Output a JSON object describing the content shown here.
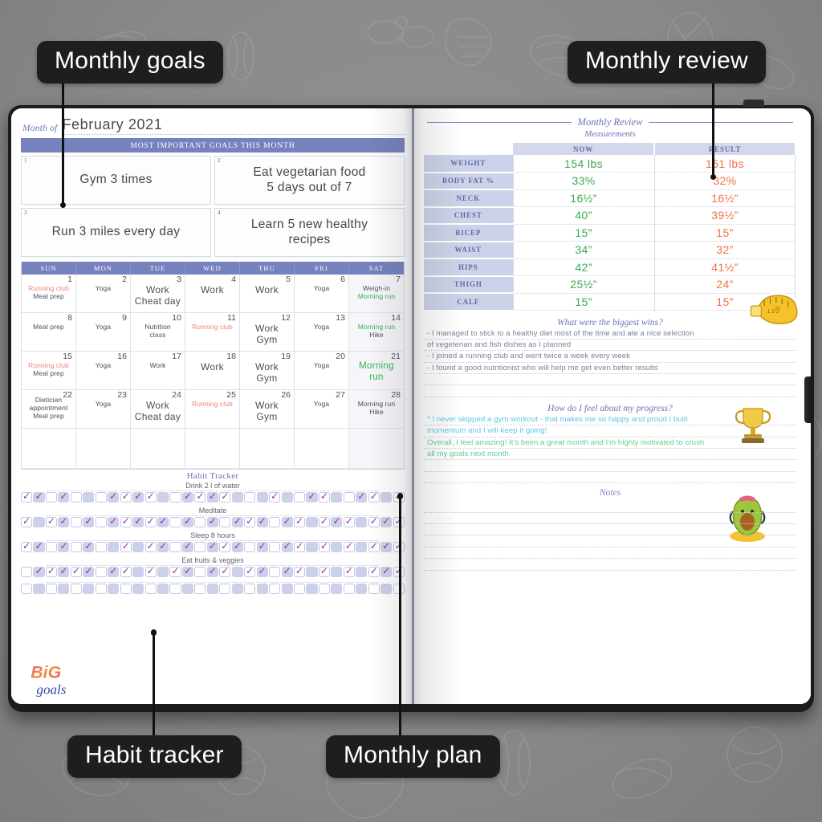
{
  "callouts": [
    {
      "label": "Monthly goals",
      "name": "callout-monthly-goals"
    },
    {
      "label": "Monthly review",
      "name": "callout-monthly-review"
    },
    {
      "label": "Habit tracker",
      "name": "callout-habit-tracker"
    },
    {
      "label": "Monthly plan",
      "name": "callout-monthly-plan"
    }
  ],
  "left_page": {
    "month_label": "Month of",
    "month_value": "February 2021",
    "goals_header": "MOST IMPORTANT GOALS THIS MONTH",
    "goals": [
      {
        "num": "1",
        "text": "Gym 3 times"
      },
      {
        "num": "2",
        "text": "Eat vegetarian food\n5 days out of 7"
      },
      {
        "num": "3",
        "text": "Run 3 miles every day"
      },
      {
        "num": "4",
        "text": "Learn 5 new healthy\nrecipes"
      }
    ],
    "weekday_headers": [
      "SUN",
      "MON",
      "TUE",
      "WED",
      "THU",
      "FRI",
      "SAT"
    ],
    "calendar": [
      [
        {
          "num": "1",
          "events": [
            {
              "t": "Running club",
              "c": "red"
            },
            {
              "t": "Meal prep",
              "c": "gray"
            }
          ]
        },
        {
          "num": "2",
          "events": [
            {
              "t": "Yoga",
              "c": "gray"
            }
          ]
        },
        {
          "num": "3",
          "events": [
            {
              "t": "Work",
              "c": "gray",
              "big": true
            },
            {
              "t": "Cheat day",
              "c": "gray",
              "big": true
            }
          ]
        },
        {
          "num": "4",
          "events": [
            {
              "t": "Work",
              "c": "gray",
              "big": true
            }
          ]
        },
        {
          "num": "5",
          "events": [
            {
              "t": "Work",
              "c": "gray",
              "big": true
            }
          ]
        },
        {
          "num": "6",
          "events": [
            {
              "t": "Yoga",
              "c": "gray"
            }
          ]
        },
        {
          "num": "7",
          "events": [
            {
              "t": "Weigh-in",
              "c": "gray"
            },
            {
              "t": "Morning run",
              "c": "green"
            }
          ]
        }
      ],
      [
        {
          "num": "8",
          "events": [
            {
              "t": "Meal prep",
              "c": "gray"
            }
          ]
        },
        {
          "num": "9",
          "events": [
            {
              "t": "Yoga",
              "c": "gray"
            }
          ]
        },
        {
          "num": "10",
          "events": [
            {
              "t": "Nutrition",
              "c": "gray"
            },
            {
              "t": "class",
              "c": "gray"
            }
          ]
        },
        {
          "num": "11",
          "events": [
            {
              "t": "Running club",
              "c": "red"
            }
          ]
        },
        {
          "num": "12",
          "events": [
            {
              "t": "Work",
              "c": "gray",
              "big": true
            },
            {
              "t": "Gym",
              "c": "gray",
              "big": true
            }
          ]
        },
        {
          "num": "13",
          "events": [
            {
              "t": "Yoga",
              "c": "gray"
            }
          ]
        },
        {
          "num": "14",
          "events": [
            {
              "t": "Morning run",
              "c": "green"
            },
            {
              "t": "Hike",
              "c": "gray"
            }
          ]
        }
      ],
      [
        {
          "num": "15",
          "events": [
            {
              "t": "Running club",
              "c": "red"
            },
            {
              "t": "Meal prep",
              "c": "gray"
            }
          ]
        },
        {
          "num": "16",
          "events": [
            {
              "t": "Yoga",
              "c": "gray"
            }
          ]
        },
        {
          "num": "17",
          "events": [
            {
              "t": "Work",
              "c": "gray"
            }
          ]
        },
        {
          "num": "18",
          "events": [
            {
              "t": "Work",
              "c": "gray",
              "big": true
            }
          ]
        },
        {
          "num": "19",
          "events": [
            {
              "t": "Work",
              "c": "gray",
              "big": true
            },
            {
              "t": "Gym",
              "c": "gray",
              "big": true
            }
          ]
        },
        {
          "num": "20",
          "events": [
            {
              "t": "Yoga",
              "c": "gray"
            }
          ]
        },
        {
          "num": "21",
          "events": [
            {
              "t": "Morning",
              "c": "green",
              "big": true
            },
            {
              "t": "run",
              "c": "green",
              "big": true
            }
          ]
        }
      ],
      [
        {
          "num": "22",
          "events": [
            {
              "t": "Dietician",
              "c": "gray"
            },
            {
              "t": "appointment",
              "c": "gray"
            },
            {
              "t": "Meal prep",
              "c": "gray"
            }
          ]
        },
        {
          "num": "23",
          "events": [
            {
              "t": "Yoga",
              "c": "gray"
            }
          ]
        },
        {
          "num": "24",
          "events": [
            {
              "t": "Work",
              "c": "gray",
              "big": true
            },
            {
              "t": "Cheat day",
              "c": "gray",
              "big": true
            }
          ]
        },
        {
          "num": "25",
          "events": [
            {
              "t": "Running club",
              "c": "red"
            }
          ]
        },
        {
          "num": "26",
          "events": [
            {
              "t": "Work",
              "c": "gray",
              "big": true
            },
            {
              "t": "Gym",
              "c": "gray",
              "big": true
            }
          ]
        },
        {
          "num": "27",
          "events": [
            {
              "t": "Yoga",
              "c": "gray"
            }
          ]
        },
        {
          "num": "28",
          "events": [
            {
              "t": "Morning run",
              "c": "gray"
            },
            {
              "t": "Hike",
              "c": "gray"
            }
          ]
        }
      ],
      [
        {
          "num": "",
          "events": []
        },
        {
          "num": "",
          "events": []
        },
        {
          "num": "",
          "events": []
        },
        {
          "num": "",
          "events": []
        },
        {
          "num": "",
          "events": []
        },
        {
          "num": "",
          "events": []
        },
        {
          "num": "",
          "events": []
        }
      ]
    ],
    "sticker_big_goals": {
      "line1": "BiG",
      "line2": "goals"
    },
    "habit_tracker": {
      "title": "Habit Tracker",
      "rows": [
        {
          "label": "Drink 2 l of water",
          "checks": [
            1,
            1,
            0,
            1,
            0,
            0,
            0,
            1,
            1,
            1,
            1,
            0,
            0,
            1,
            1,
            1,
            1,
            0,
            0,
            0,
            1,
            0,
            0,
            1,
            1,
            0,
            0,
            1,
            1,
            0,
            1
          ]
        },
        {
          "label": "Meditate",
          "checks": [
            1,
            0,
            1,
            1,
            0,
            1,
            0,
            1,
            1,
            1,
            1,
            1,
            0,
            1,
            0,
            1,
            0,
            1,
            1,
            1,
            0,
            1,
            1,
            0,
            1,
            1,
            1,
            0,
            1,
            1,
            1
          ]
        },
        {
          "label": "Sleep 8 hours",
          "checks": [
            1,
            1,
            0,
            1,
            0,
            1,
            0,
            0,
            1,
            0,
            1,
            1,
            0,
            1,
            0,
            1,
            1,
            1,
            0,
            1,
            0,
            1,
            1,
            0,
            1,
            0,
            1,
            0,
            1,
            1,
            1
          ]
        },
        {
          "label": "Eat fruits & veggies",
          "checks": [
            0,
            1,
            1,
            1,
            1,
            1,
            0,
            1,
            1,
            0,
            1,
            0,
            1,
            1,
            0,
            1,
            1,
            0,
            1,
            1,
            0,
            1,
            1,
            0,
            1,
            0,
            1,
            0,
            1,
            1,
            1
          ]
        },
        {
          "label": "",
          "checks": [
            0,
            0,
            0,
            0,
            0,
            0,
            0,
            0,
            0,
            0,
            0,
            0,
            0,
            0,
            0,
            0,
            0,
            0,
            0,
            0,
            0,
            0,
            0,
            0,
            0,
            0,
            0,
            0,
            0,
            0,
            0
          ]
        }
      ]
    }
  },
  "right_page": {
    "review_title": "Monthly Review",
    "measurements_title": "Measurements",
    "table_headers": [
      "",
      "NOW",
      "RESULT"
    ],
    "measurements": [
      {
        "label": "WEIGHT",
        "now": "154 lbs",
        "result": "151 lbs"
      },
      {
        "label": "BODY FAT %",
        "now": "33%",
        "result": "32%"
      },
      {
        "label": "NECK",
        "now": "16½”",
        "result": "16½”"
      },
      {
        "label": "CHEST",
        "now": "40”",
        "result": "39½”"
      },
      {
        "label": "BICEP",
        "now": "15”",
        "result": "15”"
      },
      {
        "label": "WAIST",
        "now": "34”",
        "result": "32”"
      },
      {
        "label": "HIPS",
        "now": "42”",
        "result": "41½”"
      },
      {
        "label": "THIGH",
        "now": "25½”",
        "result": "24”"
      },
      {
        "label": "CALF",
        "now": "15”",
        "result": "15”"
      }
    ],
    "wins_title": "What were the biggest wins?",
    "wins_lines": [
      "- I managed to stick to a healthy diet most of the time and ate a nice selection",
      "of vegeterian and fish dishes as I planned",
      "- I joined a running club and went twice a week every week",
      "- I found a good nutritionist who will help me get even better results",
      "",
      ""
    ],
    "progress_title": "How do I feel about my progress?",
    "progress_lines": [
      {
        "text": "* I never skipped a gym workout - that makes me so happy and proud I built",
        "color": "blue"
      },
      {
        "text": "momentum and I will keep it going!",
        "color": "blue"
      },
      {
        "text": "Overall, I feel amazing! It's been a great month and I'm highly motivated to crush",
        "color": "green"
      },
      {
        "text": "all my goals next month",
        "color": "green"
      },
      {
        "text": "",
        "color": "green"
      },
      {
        "text": "",
        "color": "green"
      }
    ],
    "notes_title": "Notes",
    "notes_lines": [
      "",
      "",
      "",
      "",
      "",
      ""
    ]
  },
  "colors": {
    "accent_purple": "#7681bd",
    "header_text": "#ffffff",
    "now_green": "#3aa94f",
    "result_orange": "#f2703f",
    "event_red": "#f0817d",
    "event_green": "#2eb54f",
    "check_purple": "#9b2aa0",
    "callout_bg": "#1e1e1e"
  }
}
